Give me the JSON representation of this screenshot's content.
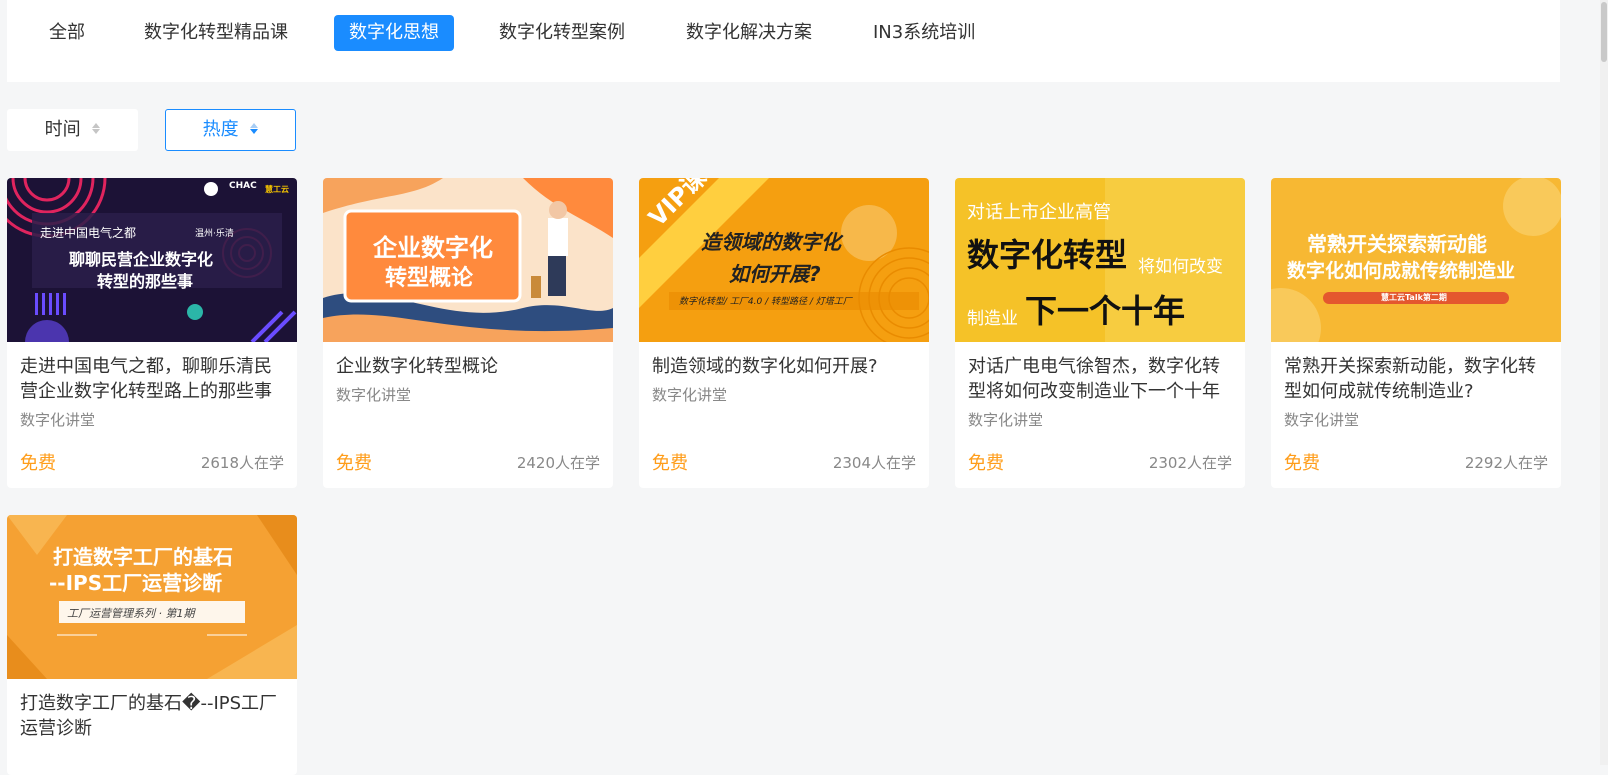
{
  "tabs": [
    {
      "label": "全部"
    },
    {
      "label": "数字化转型精品课"
    },
    {
      "label": "数字化思想"
    },
    {
      "label": "数字化转型案例"
    },
    {
      "label": "数字化解决方案"
    },
    {
      "label": "IN3系统培训"
    }
  ],
  "sort": {
    "time_label": "时间",
    "hot_label": "热度"
  },
  "courses": [
    {
      "title": "走进中国电气之都，聊聊乐清民营企业数字化转型路上的那些事",
      "category": "数字化讲堂",
      "price": "免费",
      "learners": "2618人在学",
      "banner": {
        "line1": "走进中国电气之都",
        "tag": "温州·乐清",
        "line2": "聊聊民营企业数字化",
        "line3": "转型的那些事",
        "logo": "CHAC",
        "logo2": "慧工云"
      }
    },
    {
      "title": "企业数字化转型概论",
      "category": "数字化讲堂",
      "price": "免费",
      "learners": "2420人在学",
      "banner": {
        "line1": "企业数字化",
        "line2": "转型概论"
      }
    },
    {
      "title": "制造领域的数字化如何开展?",
      "category": "数字化讲堂",
      "price": "免费",
      "learners": "2304人在学",
      "banner": {
        "ribbon": "VIP课程",
        "line1": "造领域的数字化",
        "line2": "如何开展?",
        "tags": "数字化转型/ 工厂4.0 / 转型路径 / 灯塔工厂"
      }
    },
    {
      "title": "对话广电电气徐智杰，数字化转型将如何改变制造业下一个十年",
      "category": "数字化讲堂",
      "price": "免费",
      "learners": "2302人在学",
      "banner": {
        "line1": "对话上市企业高管",
        "line2": "数字化转型",
        "line2b": "将如何改变",
        "line3a": "制造业",
        "line3b": "下一个十年"
      }
    },
    {
      "title": "常熟开关探索新动能，数字化转型如何成就传统制造业?",
      "category": "数字化讲堂",
      "price": "免费",
      "learners": "2292人在学",
      "banner": {
        "line1": "常熟开关探索新动能",
        "line2": "数字化如何成就传统制造业",
        "tag": "慧工云Talk第二期"
      }
    },
    {
      "title": "打造数字工厂的基石�--IPS工厂运营诊断",
      "category": "",
      "price": "",
      "learners": "",
      "banner": {
        "line1": "打造数字工厂的基石",
        "line2": "--IPS工厂运营诊断",
        "tag": "工厂运营管理系列 · 第1期"
      }
    }
  ]
}
